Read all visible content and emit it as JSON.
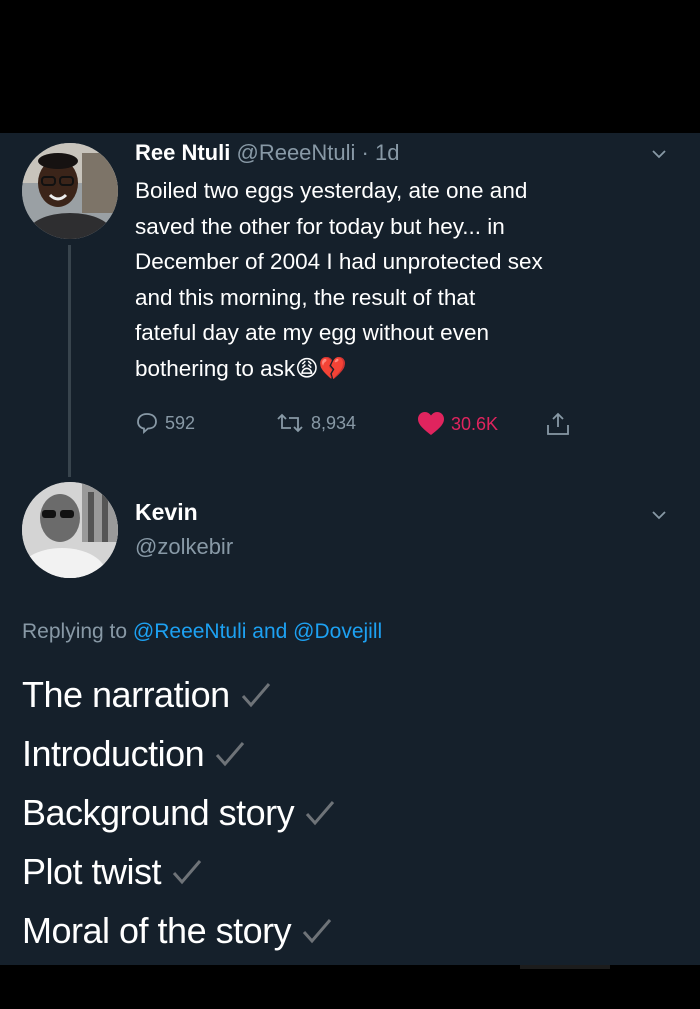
{
  "tweet": {
    "author_name": "Ree Ntuli",
    "author_handle": "@ReeeNtuli",
    "separator": "·",
    "time": "1d",
    "text_lines": [
      "Boiled two eggs yesterday, ate one and",
      "saved the other for today but hey... in",
      "December of 2004 I had unprotected sex",
      "and this morning, the result of that",
      "fateful day ate my egg without even",
      "bothering to ask"
    ],
    "emoji": [
      "😩",
      "💔"
    ],
    "actions": {
      "replies": "592",
      "retweets": "8,934",
      "likes": "30.6K"
    }
  },
  "reply": {
    "author_name": "Kevin",
    "author_handle": "@zolkebir",
    "replying_prefix": "Replying to",
    "mention_1": "@ReeeNtuli",
    "conjunction": "and",
    "mention_2": "@Dovejill",
    "items": [
      "The narration",
      "Introduction",
      "Background story",
      "Plot twist",
      "Moral of the story"
    ]
  },
  "colors": {
    "background": "#15202b",
    "secondary_text": "#8899a6",
    "link": "#1da1f2",
    "like": "#e0245e",
    "check": "#6e7378"
  },
  "icons": [
    "chevron-down-icon",
    "reply-icon",
    "retweet-icon",
    "heart-icon",
    "share-icon",
    "check-icon"
  ]
}
